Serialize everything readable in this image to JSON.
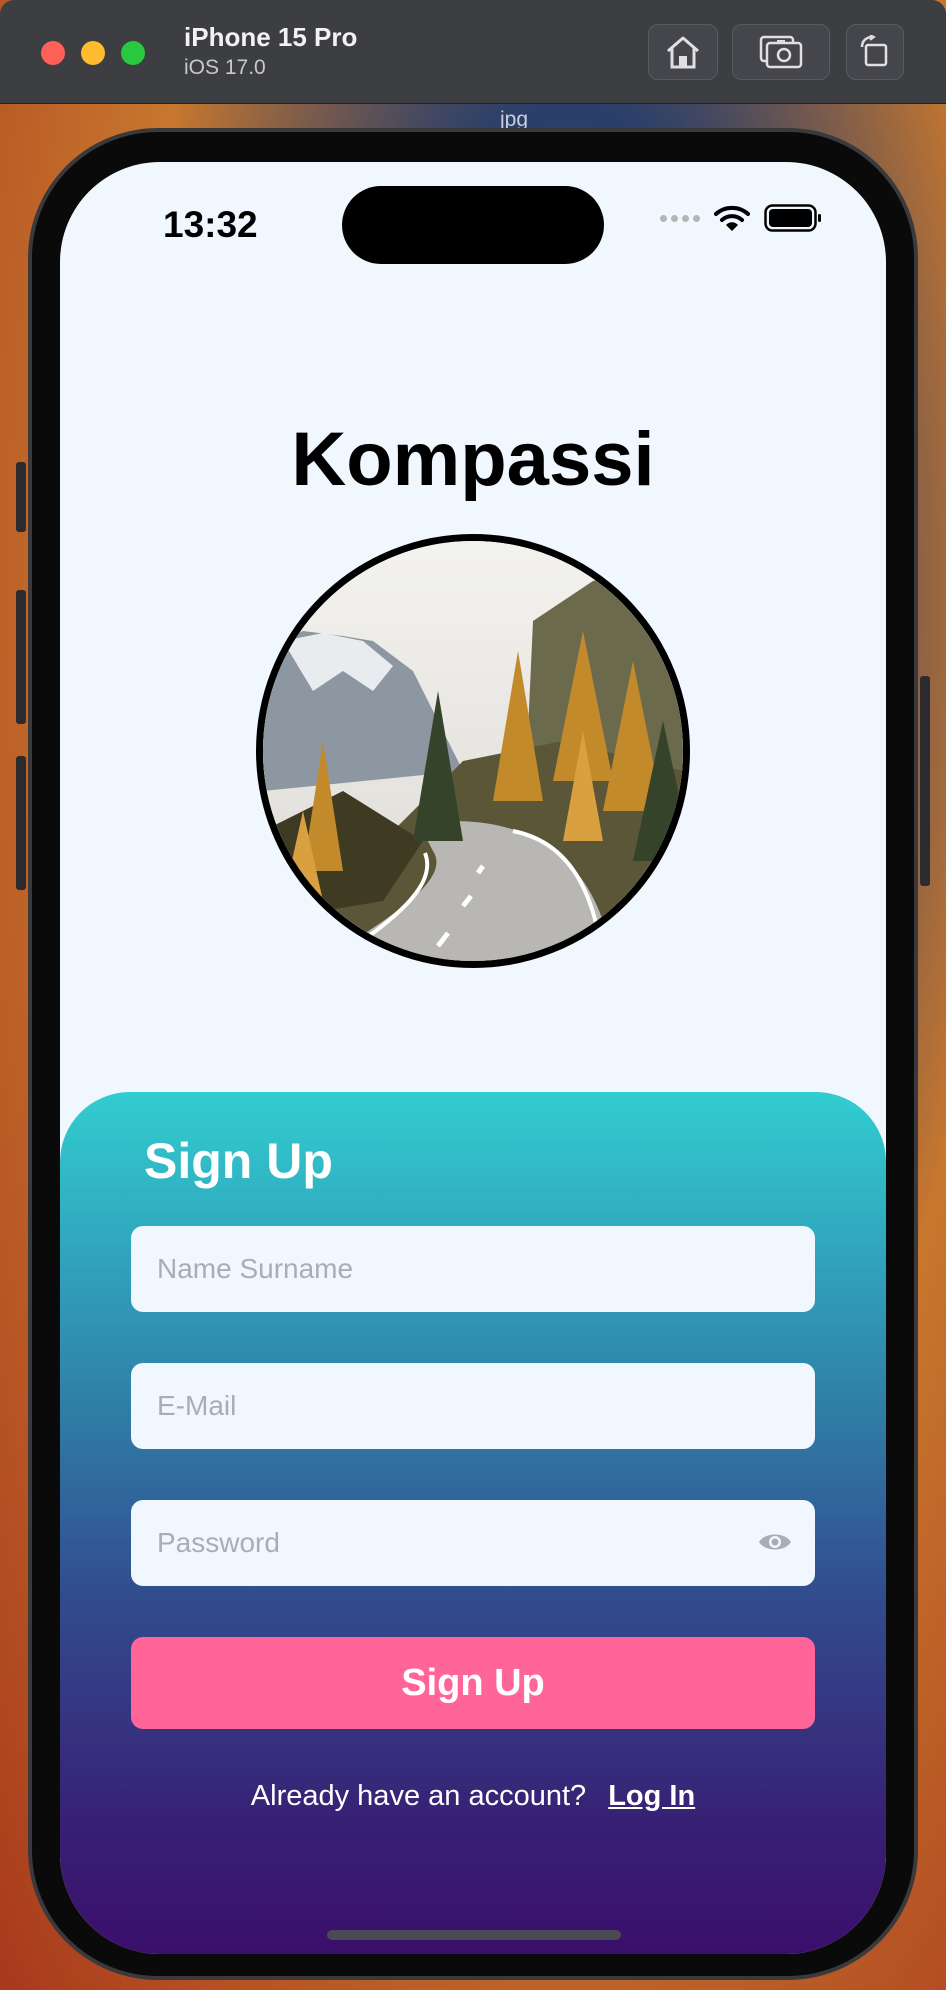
{
  "simulator": {
    "device_name": "iPhone 15 Pro",
    "os_version": "iOS 17.0",
    "window_label": "jpg",
    "buttons": [
      "home-icon",
      "screenshot-icon",
      "rotate-icon"
    ]
  },
  "status_bar": {
    "time": "13:32"
  },
  "app": {
    "title": "Kompassi",
    "hero_image": "mountain-road-autumn-forest"
  },
  "signup": {
    "heading": "Sign Up",
    "name_placeholder": "Name Surname",
    "email_placeholder": "E-Mail",
    "password_placeholder": "Password",
    "submit_label": "Sign Up",
    "footer_text": "Already have an account?",
    "login_link": "Log In"
  },
  "colors": {
    "accent_button": "#ff6598",
    "gradient_top": "#31cdd0",
    "gradient_bottom": "#3a0f6c",
    "field_background": "#f0f7ff"
  }
}
